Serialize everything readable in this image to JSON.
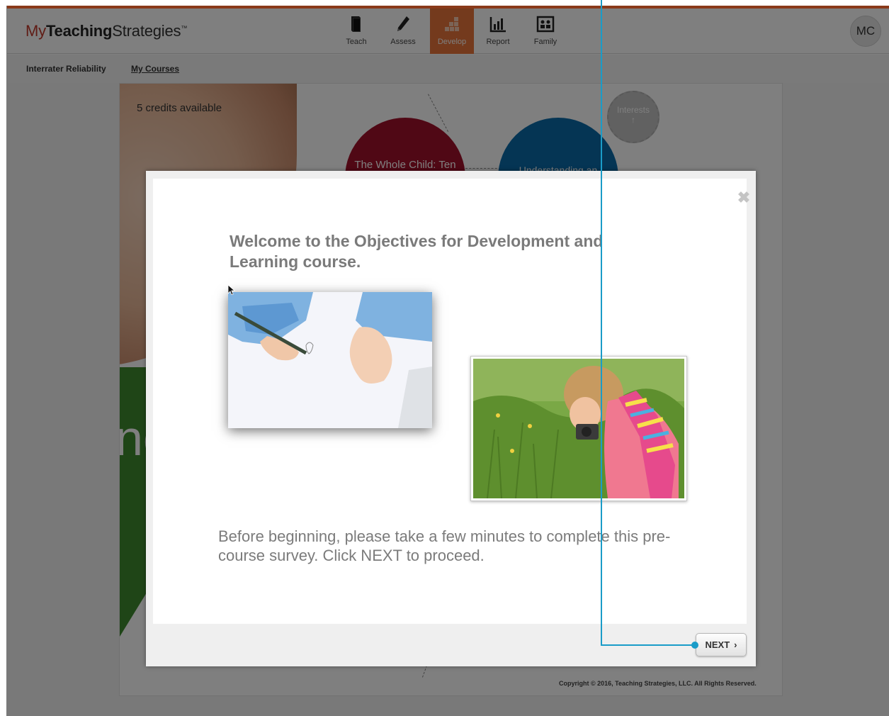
{
  "header": {
    "logo": {
      "my": "My",
      "teaching": "Teaching",
      "strategies": "Strategies",
      "tm": "™"
    },
    "nav": [
      {
        "label": "Teach",
        "icon": "book-icon"
      },
      {
        "label": "Assess",
        "icon": "pencil-icon"
      },
      {
        "label": "Develop",
        "icon": "develop-blocks-icon",
        "active": true
      },
      {
        "label": "Report",
        "icon": "bar-chart-icon"
      },
      {
        "label": "Family",
        "icon": "family-icon"
      }
    ],
    "avatar_initials": "MC"
  },
  "subnav": {
    "interrater": "Interrater Reliability",
    "my_courses": "My Courses"
  },
  "course_map": {
    "credits": "5 credits available",
    "whole_child": "The Whole Child: Ten",
    "understanding": "Understanding an",
    "interests": "Interests",
    "interests_arrow": "↑",
    "partial_letters": "nc"
  },
  "modal": {
    "heading": "Welcome to the Objectives for Development and Learning course.",
    "body": "Before beginning, please take a few minutes to complete this pre-course survey. Click NEXT to proceed.",
    "next_label": "NEXT",
    "close_glyph": "✖"
  },
  "footer": {
    "copyright": "Copyright © 2016, Teaching Strategies, LLC. All Rights Reserved."
  },
  "colors": {
    "accent_orange": "#e8743b",
    "whole_child_red": "#a0102a",
    "understanding_blue": "#0b6aa8",
    "annotation_line": "#1a9cc8"
  }
}
